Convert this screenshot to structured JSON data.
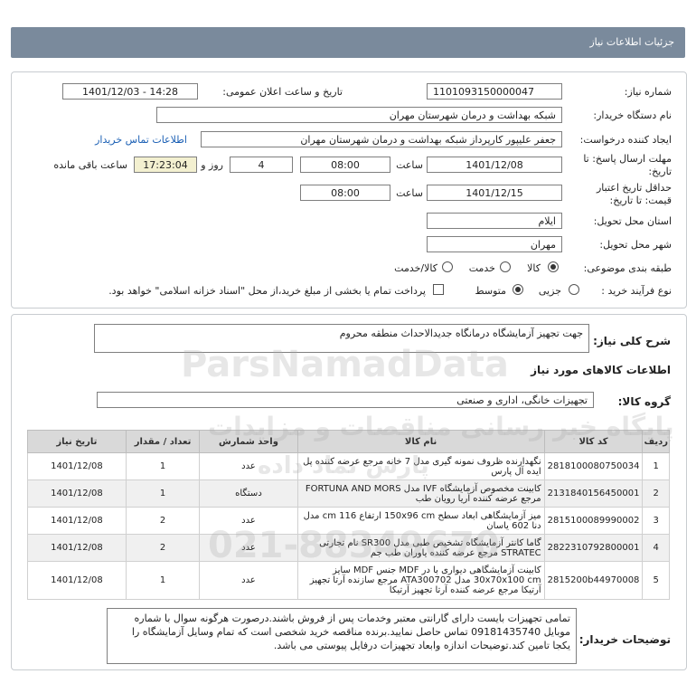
{
  "header": {
    "title": "جزئیات اطلاعات نیاز"
  },
  "form": {
    "need_number_label": "شماره نیاز:",
    "need_number": "1101093150000047",
    "announce_label": "تاریخ و ساعت اعلان عمومی:",
    "announce_value": "1401/12/03 - 14:28",
    "buyer_org_label": "نام دستگاه خریدار:",
    "buyer_org": "شبکه بهداشت و درمان شهرستان مهران",
    "requester_label": "ایجاد کننده درخواست:",
    "requester": "جعفر علیپور کارپرداز شبکه بهداشت و درمان شهرستان مهران",
    "contact_link": "اطلاعات تماس خریدار",
    "deadline_label_1": "مهلت ارسال پاسخ: تا",
    "deadline_label_2": "تاریخ:",
    "deadline_date": "1401/12/08",
    "time_label": "ساعت",
    "deadline_time": "08:00",
    "days_value": "4",
    "days_label": "روز و",
    "remaining_time": "17:23:04",
    "remaining_label": "ساعت باقی مانده",
    "validity_label_1": "حداقل تاریخ اعتبار",
    "validity_label_2": "قیمت: تا تاریخ:",
    "validity_date": "1401/12/15",
    "validity_time": "08:00",
    "province_label": "استان محل تحویل:",
    "province": "ایلام",
    "city_label": "شهر محل تحویل:",
    "city": "مهران",
    "category_label": "طبقه بندی موضوعی:",
    "category_options": [
      "کالا",
      "خدمت",
      "کالا/خدمت"
    ],
    "category_selected": "کالا",
    "process_label": "نوع فرآیند خرید :",
    "process_options": [
      "جزیی",
      "متوسط"
    ],
    "process_selected": "متوسط",
    "payment_note": "پرداخت تمام یا بخشی از مبلغ خرید،از محل \"اسناد خزانه اسلامی\" خواهد بود."
  },
  "summary": {
    "label": "شرح کلی نیاز:",
    "value": "جهت تجهیز آزمایشگاه درمانگاه جدیدالاحداث منطقه محروم"
  },
  "goods": {
    "section_title": "اطلاعات کالاهای مورد نیاز",
    "group_label": "گروه کالا:",
    "group_value": "تجهیزات خانگی، اداری و صنعتی"
  },
  "table": {
    "columns": [
      "ردیف",
      "کد کالا",
      "نام کالا",
      "واحد شمارش",
      "تعداد / مقدار",
      "تاریخ نیاز"
    ],
    "rows": [
      {
        "row": "1",
        "code": "2818100080750034",
        "name": "نگهدارنده ظروف نمونه گیری مدل 7 خانه مرجع عرضه کننده پل ایده آل پارس",
        "unit": "عدد",
        "qty": "1",
        "date": "1401/12/08"
      },
      {
        "row": "2",
        "code": "2131840156450001",
        "name": "کابینت مخصوص آزمایشگاه IVF مدل FORTUNA AND MORS مرجع عرضه کننده آریا رویان طب",
        "unit": "دستگاه",
        "qty": "1",
        "date": "1401/12/08"
      },
      {
        "row": "3",
        "code": "2815100089990002",
        "name": "میز آزمایشگاهی ابعاد سطح 150x96 cm ارتفاع 116 cm مدل دنا 602 یاسان",
        "unit": "عدد",
        "qty": "2",
        "date": "1401/12/08"
      },
      {
        "row": "4",
        "code": "2822310792800001",
        "name": "گاما کانتر آزمایشگاه تشخیص طبی مدل SR300 نام تجارتی STRATEC مرجع عرضه کننده یاوران طب جم",
        "unit": "عدد",
        "qty": "2",
        "date": "1401/12/08"
      },
      {
        "row": "5",
        "code": "2815200b44970008",
        "name": "کابینت آزمایشگاهی دیواری با در MDF جنس MDF سایز 30x70x100 cm مدل ATA300702 مرجع سازنده آرتا تجهیز آرتیکا مرجع عرضه کننده آرتا تجهیز آرتیکا",
        "unit": "عدد",
        "qty": "1",
        "date": "1401/12/08"
      }
    ]
  },
  "buyer_notes": {
    "label": "توضیحات خریدار:",
    "text": "تمامی تجهیزات بایست دارای گارانتی معتبر وخدمات پس از فروش باشند.درصورت هرگونه سوال با شماره موبایل 09181435740 تماس حاصل نمایید.برنده مناقصه خرید شخصی است که تمام وسایل آزمایشگاه را یکجا تامین کند.توضیحات اندازه وابعاد تجهیزات درفایل پیوستی می باشد."
  },
  "watermark": {
    "brand": "ParsNamadData",
    "line1": "پایگاه خبر رسانی مناقصات و مزایدات",
    "line2": "پارس نماد داده",
    "phone": "021-88349670"
  }
}
